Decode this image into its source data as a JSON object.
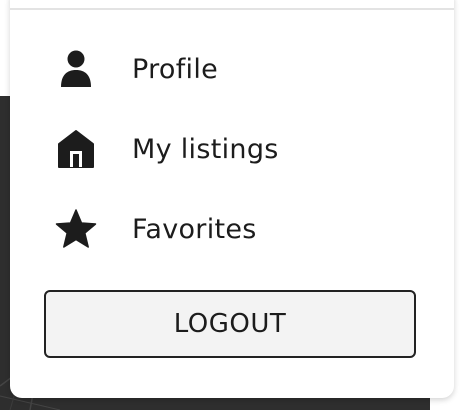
{
  "background": {
    "color": "#2e2e2e"
  },
  "menu": {
    "items": [
      {
        "label": "Profile",
        "icon": "person-icon"
      },
      {
        "label": "My listings",
        "icon": "home-icon"
      },
      {
        "label": "Favorites",
        "icon": "star-icon"
      }
    ],
    "logout_label": "LOGOUT"
  },
  "colors": {
    "text": "#1c1c1c",
    "icon": "#1c1c1c",
    "button_bg": "#f3f3f3",
    "button_border": "#222222"
  }
}
